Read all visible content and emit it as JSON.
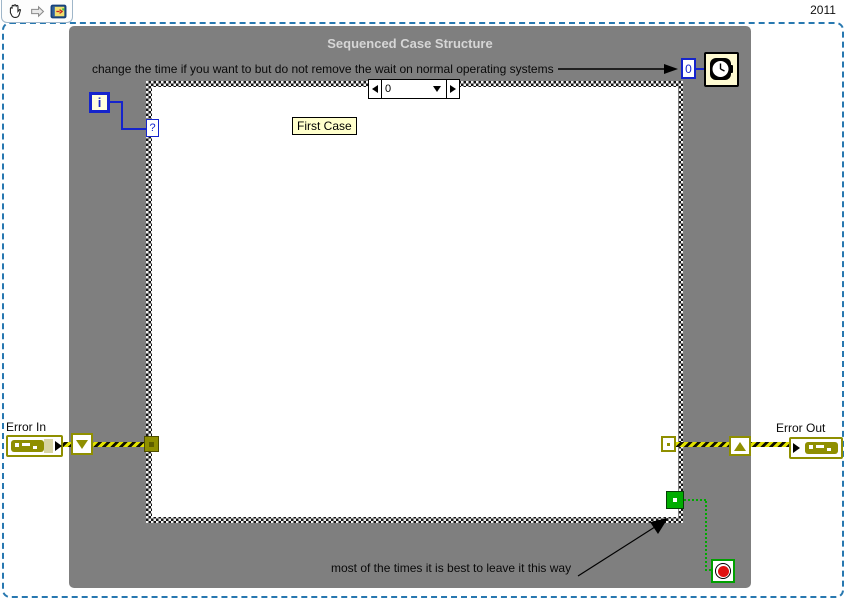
{
  "toolbar": {
    "icons": [
      {
        "name": "pan-hand-icon"
      },
      {
        "name": "step-arrow-icon"
      },
      {
        "name": "vi-snippet-icon"
      }
    ]
  },
  "version_label": "2011",
  "snippet": {
    "title": "Sequenced Case Structure",
    "top_comment": "change the time if you want to but do not remove the wait on normal operating systems",
    "bottom_comment": "most of the times it is best to leave it this way",
    "case_label": "First Case",
    "selector_value": "0",
    "wait_ms_constant": "0",
    "iteration_terminal_label": "i",
    "case_selector_terminal_label": "?",
    "error_in_label": "Error In",
    "error_out_label": "Error Out",
    "icons": [
      {
        "name": "wait-ms-watch-icon"
      },
      {
        "name": "stop-button-terminal-icon"
      }
    ]
  },
  "colors": {
    "snippet_gray": "#7f7f7f",
    "title_gray": "#d6d6d6",
    "marquee_blue": "#2878b0",
    "labview_wire_blue": "#1524cc",
    "error_cluster_olive": "#8f8f00",
    "error_wire_yellow": "#e2e200",
    "boolean_green": "#00a800",
    "stop_red": "#e01010",
    "function_icon_cream": "#fffbd2",
    "label_yellow": "#ffffcc"
  }
}
